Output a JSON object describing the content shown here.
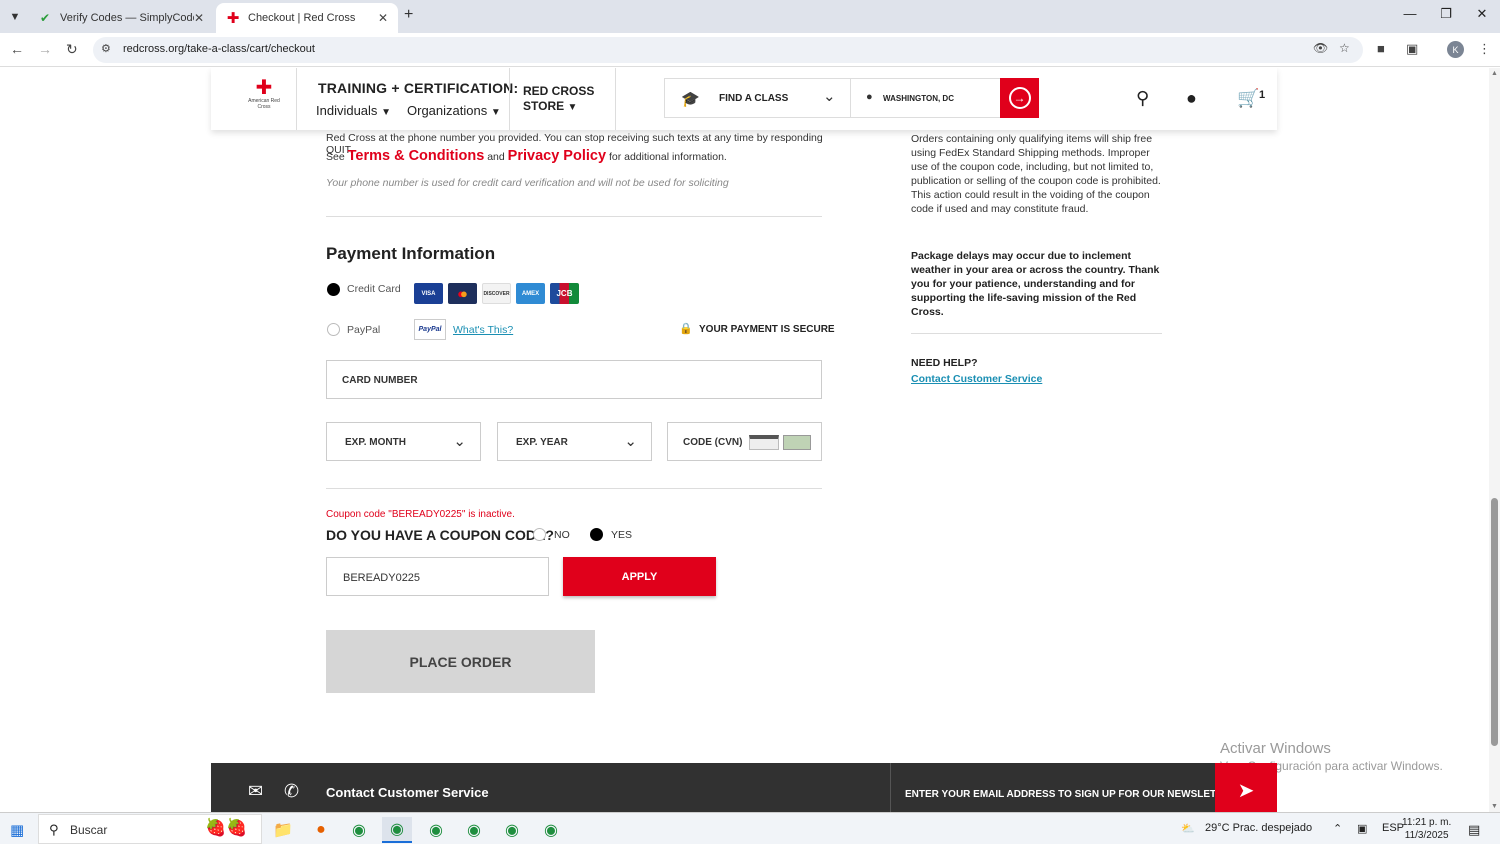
{
  "browser": {
    "tabs": [
      {
        "title": "Verify Codes — SimplyCodes",
        "active": false
      },
      {
        "title": "Checkout | Red Cross",
        "active": true
      }
    ],
    "url": "redcross.org/take-a-class/cart/checkout"
  },
  "header": {
    "logo_text": "American Red Cross",
    "training_title": "TRAINING + CERTIFICATION:",
    "menu_individuals": "Individuals",
    "menu_organizations": "Organizations",
    "store_line1": "RED CROSS",
    "store_line2": "STORE",
    "find_class": "FIND A CLASS",
    "location": "WASHINGTON, DC",
    "cart_count": "1"
  },
  "sms": {
    "line1": "Red Cross at the phone number you provided. You can stop receiving such texts at any time by responding QUIT.",
    "see": "See",
    "terms": "Terms & Conditions",
    "and": "and",
    "privacy": "Privacy Policy",
    "tail": "for additional information.",
    "note": "Your phone number is used for credit card verification and will not be used for soliciting"
  },
  "payment": {
    "title": "Payment Information",
    "credit_card_label": "Credit Card",
    "paypal_label": "PayPal",
    "paypal_logo": "PayPal",
    "whats_this": "What's This?",
    "secure": "YOUR PAYMENT IS SECURE",
    "cards": [
      "VISA",
      "MC",
      "DISCOVER",
      "AMEX",
      "JCB"
    ],
    "card_number": "CARD NUMBER",
    "exp_month": "EXP. MONTH",
    "exp_year": "EXP. YEAR",
    "cvn": "CODE (CVN)"
  },
  "coupon": {
    "error": "Coupon code \"BEREADY0225\" is inactive.",
    "question": "DO YOU HAVE A COUPON CODE?",
    "no": "NO",
    "yes": "YES",
    "value": "BEREADY0225",
    "apply": "APPLY"
  },
  "place_order": "PLACE ORDER",
  "sidebar": {
    "shipping_note": "Orders containing only qualifying items will ship free using FedEx Standard Shipping methods. Improper use of the coupon code, including, but not limited to, publication or selling of the coupon code is prohibited. This action could result in the voiding of the coupon code if used and may constitute fraud.",
    "delay_note": "Package delays may occur due to inclement weather in your area or across the country. Thank you for your patience, understanding and for supporting the life-saving mission of the Red Cross.",
    "need_help": "NEED HELP?",
    "contact": "Contact Customer Service"
  },
  "footer": {
    "contact": "Contact Customer Service",
    "newsletter": "ENTER YOUR EMAIL ADDRESS TO SIGN UP FOR OUR NEWSLETTER"
  },
  "watermark": {
    "line1": "Activar Windows",
    "line2": "Ve a Configuración para activar Windows."
  },
  "taskbar": {
    "search": "Buscar",
    "weather": "29°C  Prac. despejado",
    "lang": "ESP",
    "time": "11:21 p. m.",
    "date": "11/3/2025"
  }
}
